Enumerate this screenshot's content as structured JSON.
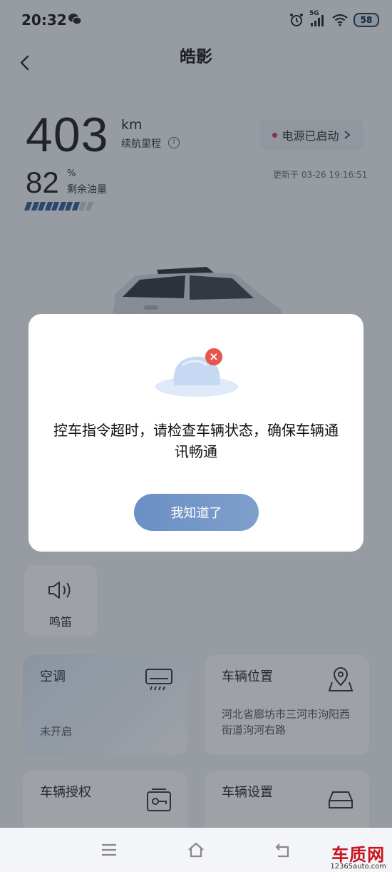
{
  "status_bar": {
    "time": "20:32",
    "network": "5G",
    "battery": "58"
  },
  "header": {
    "title": "皓影",
    "back_icon": "chevron-left-icon"
  },
  "range": {
    "value": "403",
    "unit": "km",
    "label": "续航里程",
    "info_icon": "!"
  },
  "power": {
    "label": "电源已启动",
    "status_color": "#d0364b"
  },
  "updated": "更新于 03-26 19:16:51",
  "fuel": {
    "value": "82",
    "unit": "%",
    "label": "剩余油量",
    "level": 0.82
  },
  "horn": {
    "label": "鸣笛",
    "icon": "speaker-icon"
  },
  "cards": {
    "ac": {
      "title": "空调",
      "status": "未开启",
      "icon": "air-conditioner-icon"
    },
    "location": {
      "title": "车辆位置",
      "address": "河北省廊坊市三河市泃阳西街道泃河右路",
      "icon": "map-pin-icon"
    },
    "authorization": {
      "title": "车辆授权",
      "icon": "key-card-icon"
    },
    "settings": {
      "title": "车辆设置",
      "icon": "car-front-icon"
    }
  },
  "dialog": {
    "message": "控车指令超时，请检查车辆状态，确保车辆通讯畅通",
    "button": "我知道了",
    "error_icon": "×"
  },
  "watermark": {
    "main": "车质网",
    "sub": "12365auto.com"
  },
  "colors": {
    "accent": "#6b8fc4",
    "fuel_fill": "#2e5a9b",
    "error": "#e8564b"
  }
}
